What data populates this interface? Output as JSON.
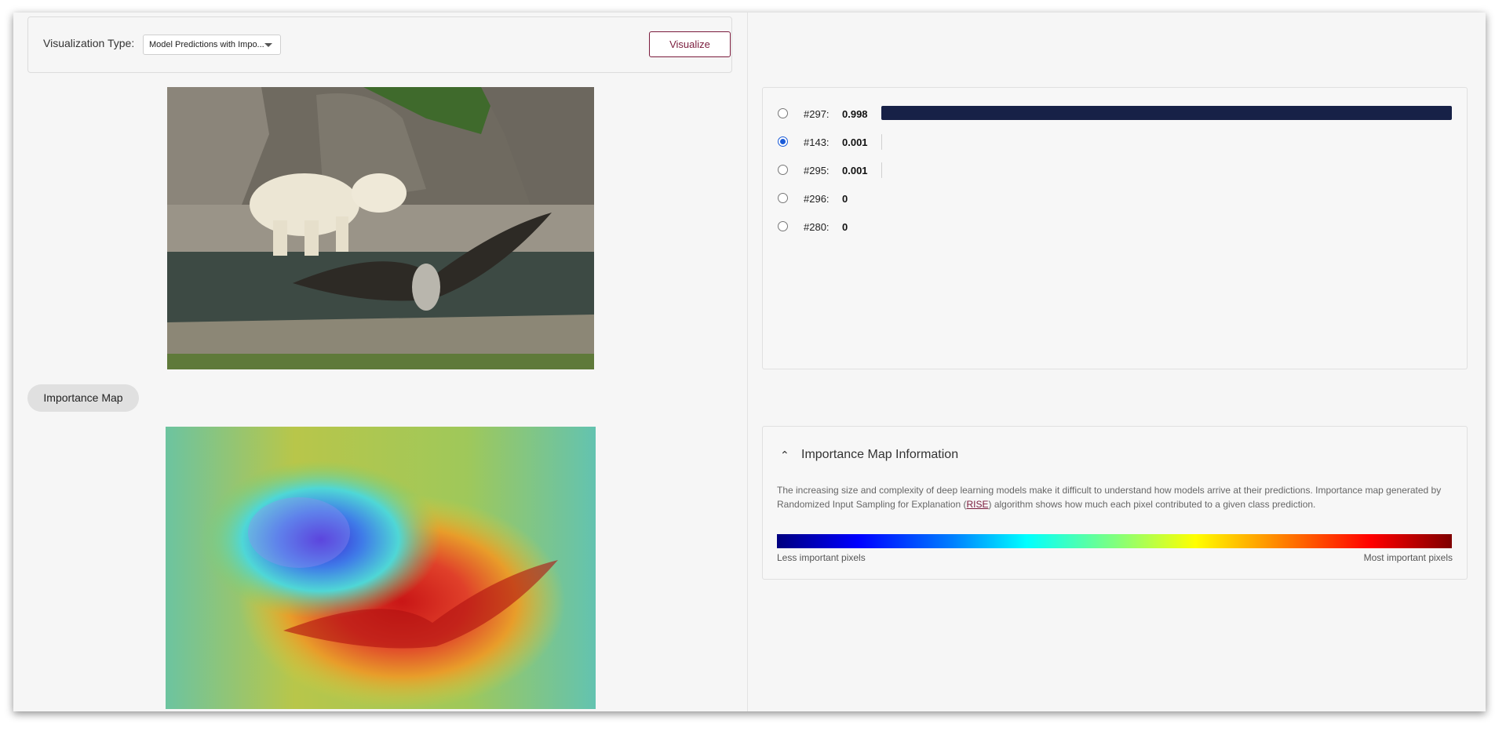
{
  "toolbar": {
    "visualization_type_label": "Visualization Type:",
    "visualization_type_value": "Model Predictions with Impo...",
    "visualize_button": "Visualize"
  },
  "importance_map_chip": "Importance Map",
  "predictions": [
    {
      "label": "#297:",
      "value": "0.998",
      "score": 0.998,
      "selected": false
    },
    {
      "label": "#143:",
      "value": "0.001",
      "score": 0.001,
      "selected": true
    },
    {
      "label": "#295:",
      "value": "0.001",
      "score": 0.001,
      "selected": false
    },
    {
      "label": "#296:",
      "value": "0",
      "score": 0,
      "selected": false
    },
    {
      "label": "#280:",
      "value": "0",
      "score": 0,
      "selected": false
    }
  ],
  "info_panel": {
    "title": "Importance Map Information",
    "text_before_link": "The increasing size and complexity of deep learning models make it difficult to understand how models arrive at their predictions. Importance map generated by Randomized Input Sampling for Explanation (",
    "link_text": "RISE",
    "text_after_link": ") algorithm shows how much each pixel contributed to a given class prediction.",
    "colorbar_low_label": "Less important pixels",
    "colorbar_high_label": "Most important pixels"
  },
  "colors": {
    "accent": "#7a1b3c",
    "bar": "#172147",
    "radio_selected": "#1a5bd8"
  }
}
